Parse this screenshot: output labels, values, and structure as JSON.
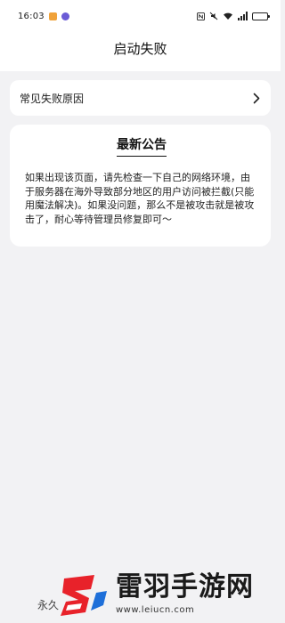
{
  "status_bar": {
    "time": "16:03",
    "icons": [
      "app-notification-icon",
      "app-badge-icon",
      "nfc-icon",
      "mute-icon",
      "wifi-icon",
      "signal-icon",
      "battery-icon"
    ],
    "battery_level": 0.85
  },
  "header": {
    "title": "启动失败"
  },
  "reasons": {
    "label": "常见失败原因"
  },
  "notice": {
    "title": "最新公告",
    "body": "如果出现该页面，请先检查一下自己的网络环境，由于服务器在海外导致部分地区的用户访问被拦截(只能用魔法解决)。如果没问题，那么不是被攻击就是被攻击了，耐心等待管理员修复即可～"
  },
  "footer": {
    "partial_text": "永久"
  },
  "watermark": {
    "name": "雷羽手游网",
    "url": "www.leiucn.com"
  },
  "colors": {
    "page_background": "#f2f2f4",
    "card_background": "#ffffff",
    "watermark_red": "#e8222a",
    "watermark_blue": "#1e6fd9"
  }
}
